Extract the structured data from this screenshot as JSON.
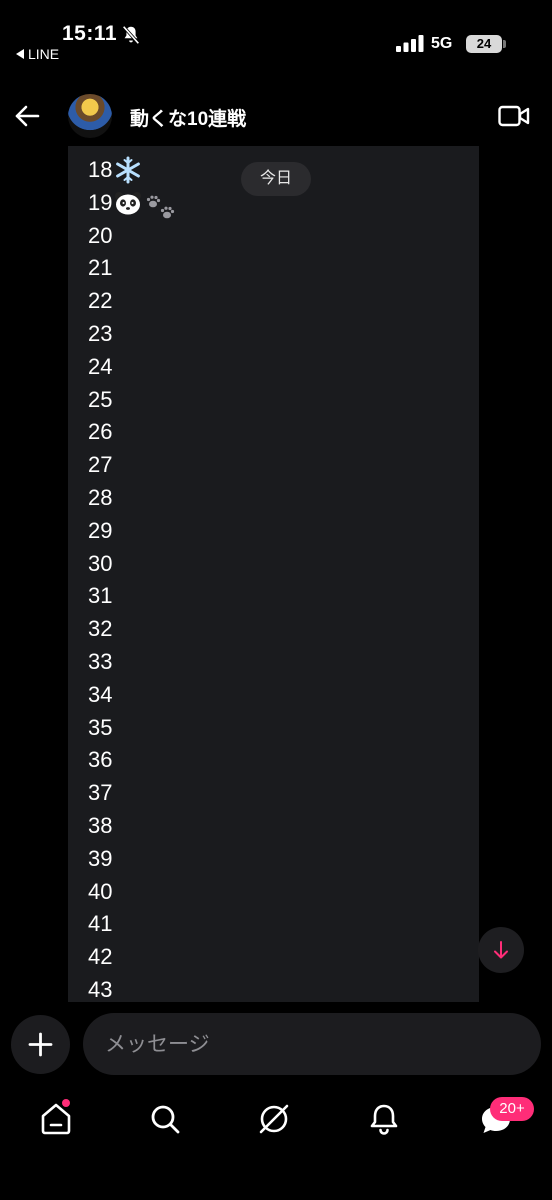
{
  "status_bar": {
    "time": "15:11",
    "back_app": "LINE",
    "network": "5G",
    "battery": "24"
  },
  "header": {
    "title": "動くな10連戦",
    "back_icon": "back-arrow-icon",
    "video_icon": "video-call-icon"
  },
  "date_pill": "今日",
  "message": {
    "lines": [
      "18",
      "19",
      "20",
      "21",
      "22",
      "23",
      "24",
      "25",
      "26",
      "27",
      "28",
      "29",
      "30",
      "31",
      "32",
      "33",
      "34",
      "35",
      "36",
      "37",
      "38",
      "39",
      "40",
      "41",
      "42",
      "43"
    ]
  },
  "composer": {
    "placeholder": "メッセージ"
  },
  "bottom_nav": {
    "items": [
      "home-icon",
      "search-icon",
      "discover-icon",
      "bell-icon",
      "chat-icon"
    ],
    "chat_badge": "20+"
  },
  "colors": {
    "accent": "#ff2d78",
    "bubble": "#1a1b1e",
    "background": "#000000"
  }
}
